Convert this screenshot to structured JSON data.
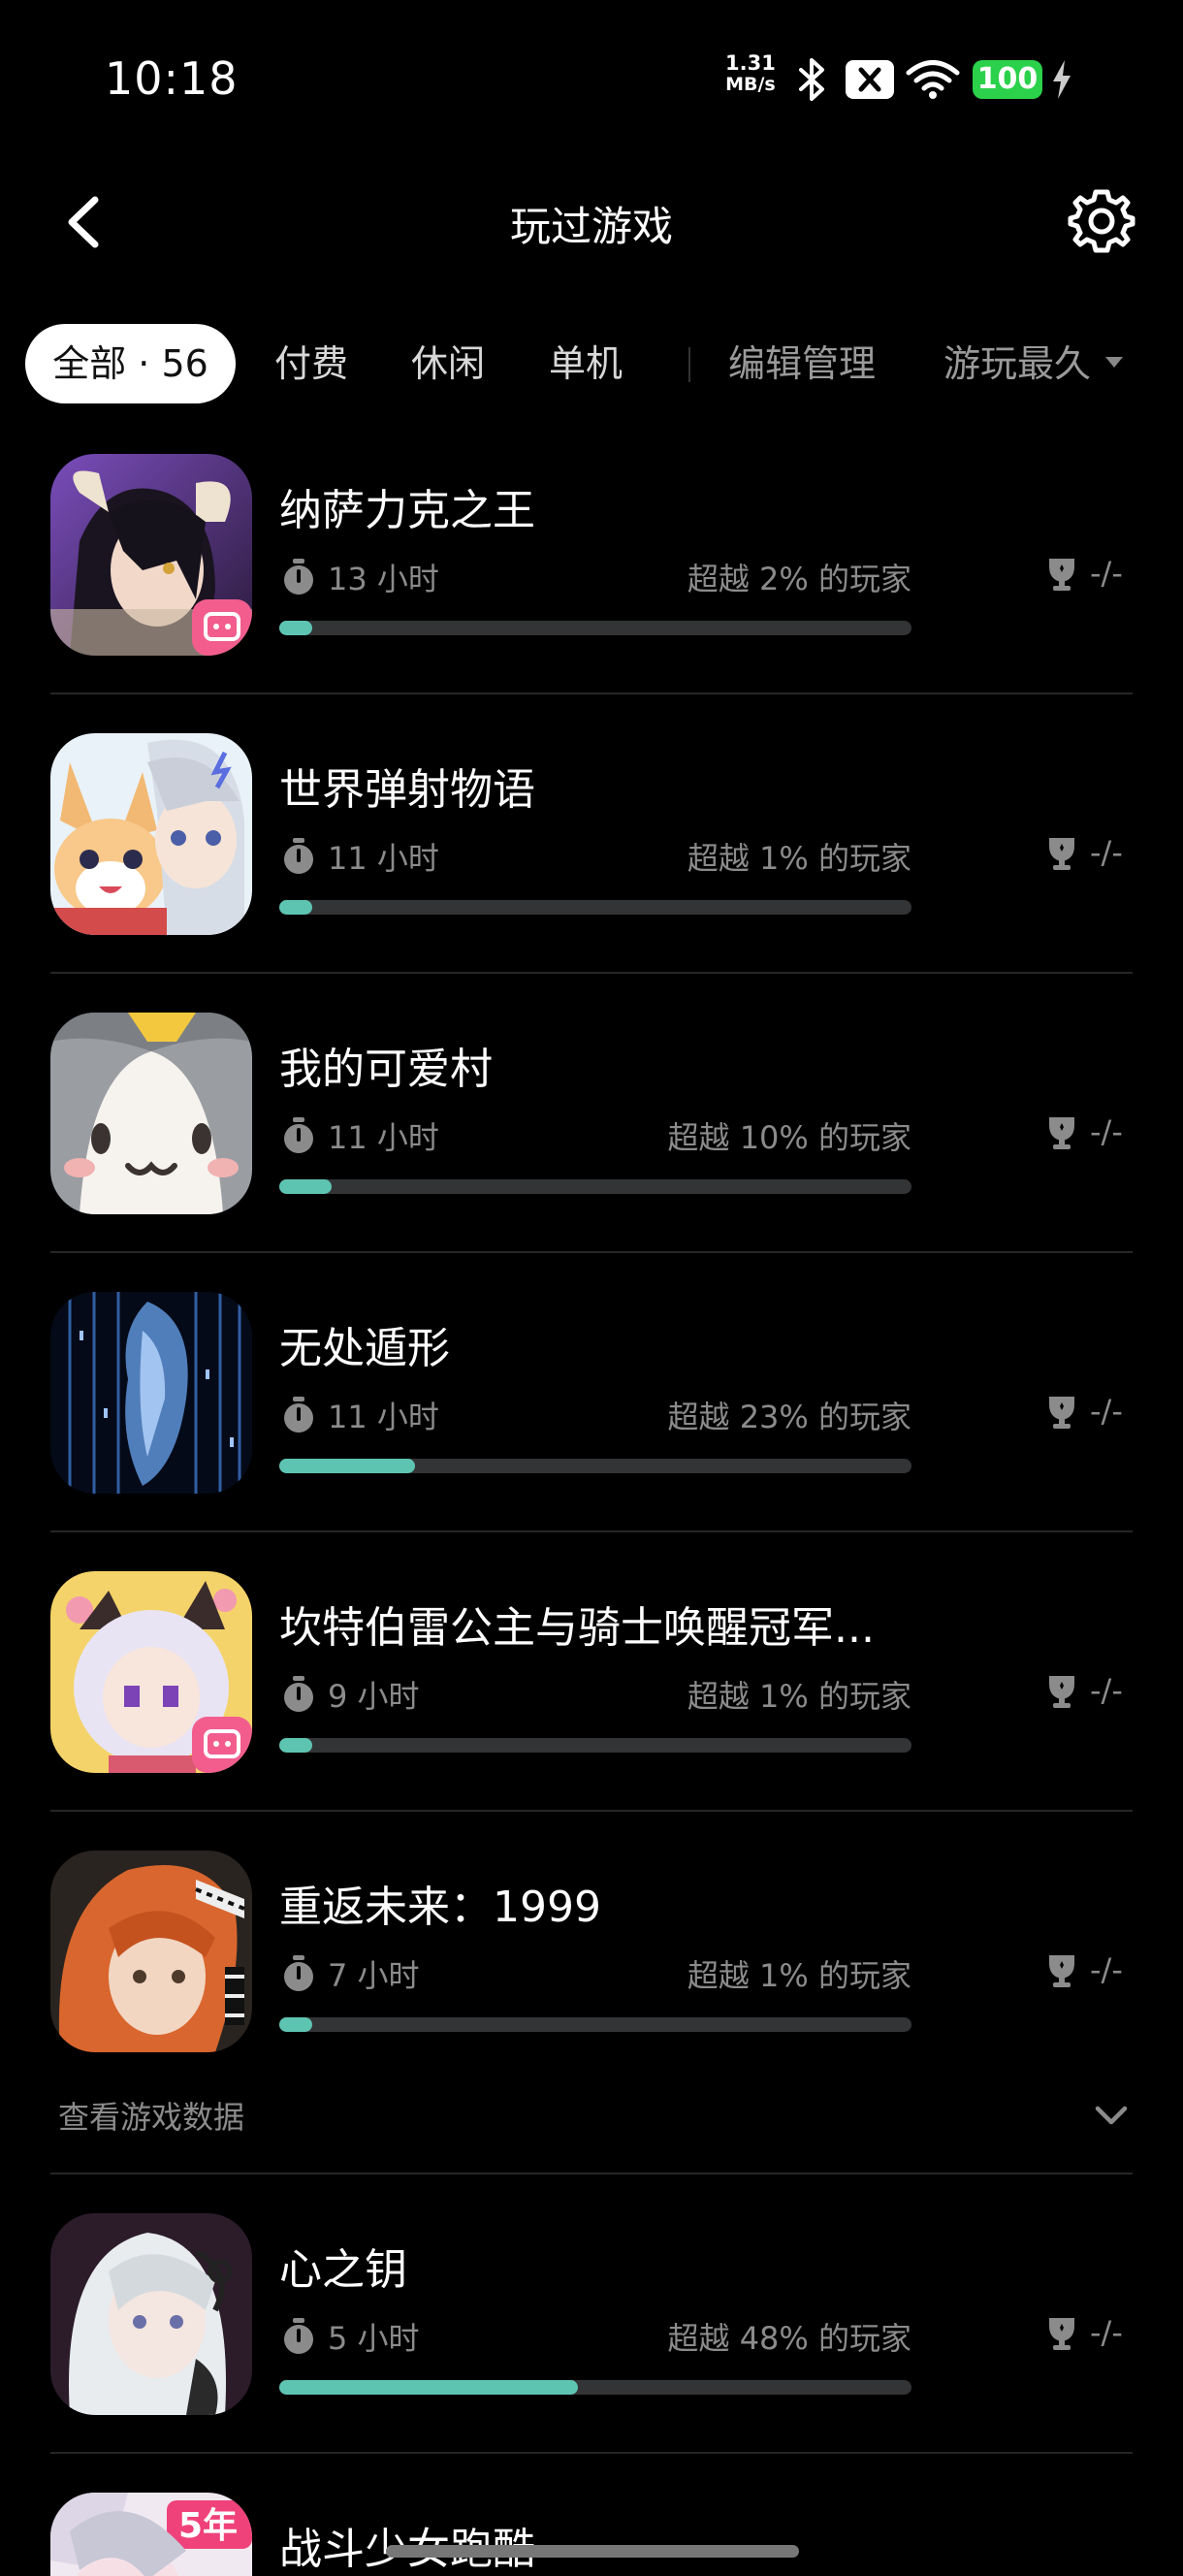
{
  "status_bar": {
    "time": "10:18",
    "net_speed_value": "1.31",
    "net_speed_unit": "MB/s",
    "battery": "100",
    "icons": [
      "bluetooth-icon",
      "mute-icon",
      "wifi-icon",
      "charging-icon"
    ]
  },
  "header": {
    "title": "玩过游戏",
    "back_icon": "chevron-left-icon",
    "settings_icon": "gear-icon"
  },
  "filters": {
    "all_label": "全部 · 56",
    "tabs": [
      "付费",
      "休闲",
      "单机"
    ],
    "edit_label": "编辑管理",
    "sort_label": "游玩最久"
  },
  "games": [
    {
      "name": "纳萨力克之王",
      "hours": "13 小时",
      "beat": "超越 2% 的玩家",
      "achievement": "-/-",
      "percentile": 2,
      "badge": "bilibili"
    },
    {
      "name": "世界弹射物语",
      "hours": "11 小时",
      "beat": "超越 1% 的玩家",
      "achievement": "-/-",
      "percentile": 1
    },
    {
      "name": "我的可爱村",
      "hours": "11 小时",
      "beat": "超越 10% 的玩家",
      "achievement": "-/-",
      "percentile": 10
    },
    {
      "name": "无处遁形",
      "hours": "11 小时",
      "beat": "超越 23% 的玩家",
      "achievement": "-/-",
      "percentile": 23
    },
    {
      "name": "坎特伯雷公主与骑士唤醒冠军...",
      "hours": "9 小时",
      "beat": "超越 1% 的玩家",
      "achievement": "-/-",
      "percentile": 1,
      "badge": "bilibili"
    },
    {
      "name": "重返未来：1999",
      "hours": "7 小时",
      "beat": "超越 1% 的玩家",
      "achievement": "-/-",
      "percentile": 1
    },
    {
      "name": "心之钥",
      "hours": "5 小时",
      "beat": "超越 48% 的玩家",
      "achievement": "-/-",
      "percentile": 48
    },
    {
      "name": "战斗少女跑酷",
      "badge_text": "5年"
    }
  ],
  "view_data_label": "查看游戏数据",
  "colors": {
    "progress_fill": "#5ec4b2",
    "progress_track": "#333436",
    "battery": "#2bd14b",
    "background": "#000000",
    "secondary_text": "#8b8b8b"
  }
}
